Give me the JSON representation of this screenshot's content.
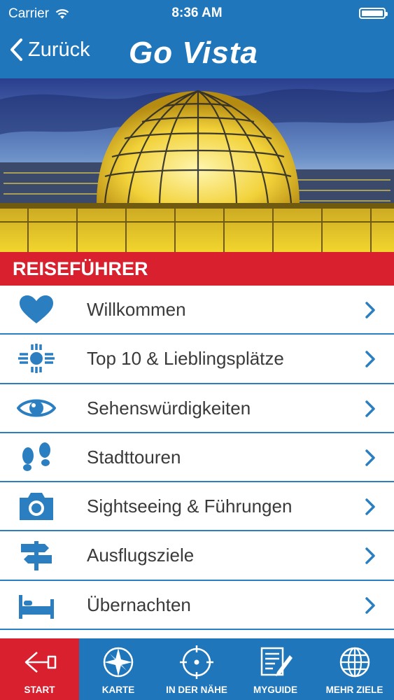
{
  "status_bar": {
    "carrier": "Carrier",
    "time": "8:36 AM"
  },
  "nav_bar": {
    "back_label": "Zurück",
    "logo_text": "Go Vista"
  },
  "section": {
    "title": "REISEFÜHRER"
  },
  "menu": {
    "items": [
      {
        "label": "Willkommen",
        "icon": "heart-icon"
      },
      {
        "label": "Top 10 & Lieblingsplätze",
        "icon": "zia-sun-icon"
      },
      {
        "label": "Sehenswürdigkeiten",
        "icon": "eye-icon"
      },
      {
        "label": "Stadttouren",
        "icon": "footprints-icon"
      },
      {
        "label": "Sightseeing & Führungen",
        "icon": "camera-icon"
      },
      {
        "label": "Ausflugsziele",
        "icon": "signpost-icon"
      },
      {
        "label": "Übernachten",
        "icon": "bed-icon"
      }
    ]
  },
  "tab_bar": {
    "tabs": [
      {
        "label": "START",
        "icon": "back-arrow-icon",
        "active": true
      },
      {
        "label": "KARTE",
        "icon": "compass-icon",
        "active": false
      },
      {
        "label": "IN DER NÄHE",
        "icon": "location-target-icon",
        "active": false
      },
      {
        "label": "MYGUIDE",
        "icon": "notepad-pen-icon",
        "active": false
      },
      {
        "label": "MEHR ZIELE",
        "icon": "globe-icon",
        "active": false
      }
    ]
  },
  "colors": {
    "brand_blue": "#1f76bb",
    "accent_red": "#d8202f",
    "icon_blue": "#2b7fc1"
  }
}
